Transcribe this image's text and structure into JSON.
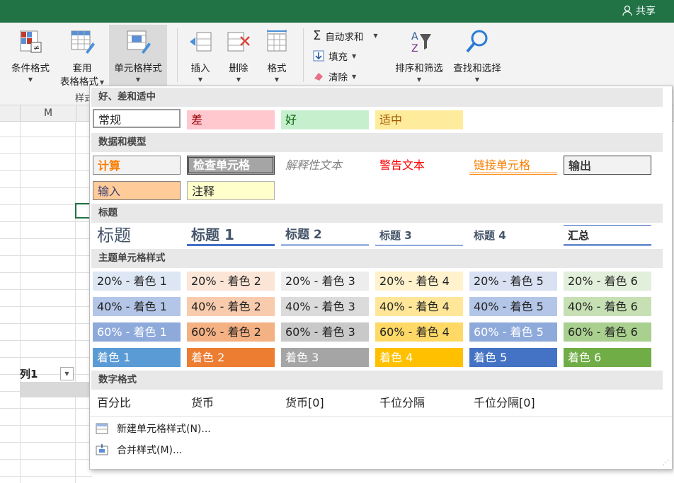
{
  "titlebar": {
    "share_label": "共享",
    "color": "#217346"
  },
  "ribbon": {
    "conditional_format": "条件格式",
    "table_format_line1": "套用",
    "table_format_line2": "表格格式",
    "cell_styles": "单元格样式",
    "insert": "插入",
    "delete": "删除",
    "format": "格式",
    "autosum": "自动求和",
    "fill": "填充",
    "clear": "清除",
    "sort_filter": "排序和筛选",
    "find_select": "查找和选择",
    "group_label_partial": "样式"
  },
  "sheet": {
    "column_header": "M",
    "table_header": "列1"
  },
  "gallery": {
    "sections": {
      "good_bad": "好、差和适中",
      "data_model": "数据和模型",
      "titles": "标题",
      "theme": "主题单元格样式",
      "number": "数字格式"
    },
    "good_bad": [
      "常规",
      "差",
      "好",
      "适中"
    ],
    "data_model": [
      "计算",
      "检查单元格",
      "解释性文本",
      "警告文本",
      "链接单元格",
      "输出",
      "输入",
      "注释"
    ],
    "titles": [
      "标题",
      "标题 1",
      "标题 2",
      "标题 3",
      "标题 4",
      "汇总"
    ],
    "theme_rows": [
      [
        "20% - 着色 1",
        "20% - 着色 2",
        "20% - 着色 3",
        "20% - 着色 4",
        "20% - 着色 5",
        "20% - 着色 6"
      ],
      [
        "40% - 着色 1",
        "40% - 着色 2",
        "40% - 着色 3",
        "40% - 着色 4",
        "40% - 着色 5",
        "40% - 着色 6"
      ],
      [
        "60% - 着色 1",
        "60% - 着色 2",
        "60% - 着色 3",
        "60% - 着色 4",
        "60% - 着色 5",
        "60% - 着色 6"
      ],
      [
        "着色 1",
        "着色 2",
        "着色 3",
        "着色 4",
        "着色 5",
        "着色 6"
      ]
    ],
    "number": [
      "百分比",
      "货币",
      "货币[0]",
      "千位分隔",
      "千位分隔[0]"
    ],
    "menu": {
      "new_style": "新建单元格样式(N)...",
      "merge_styles": "合并样式(M)..."
    }
  }
}
